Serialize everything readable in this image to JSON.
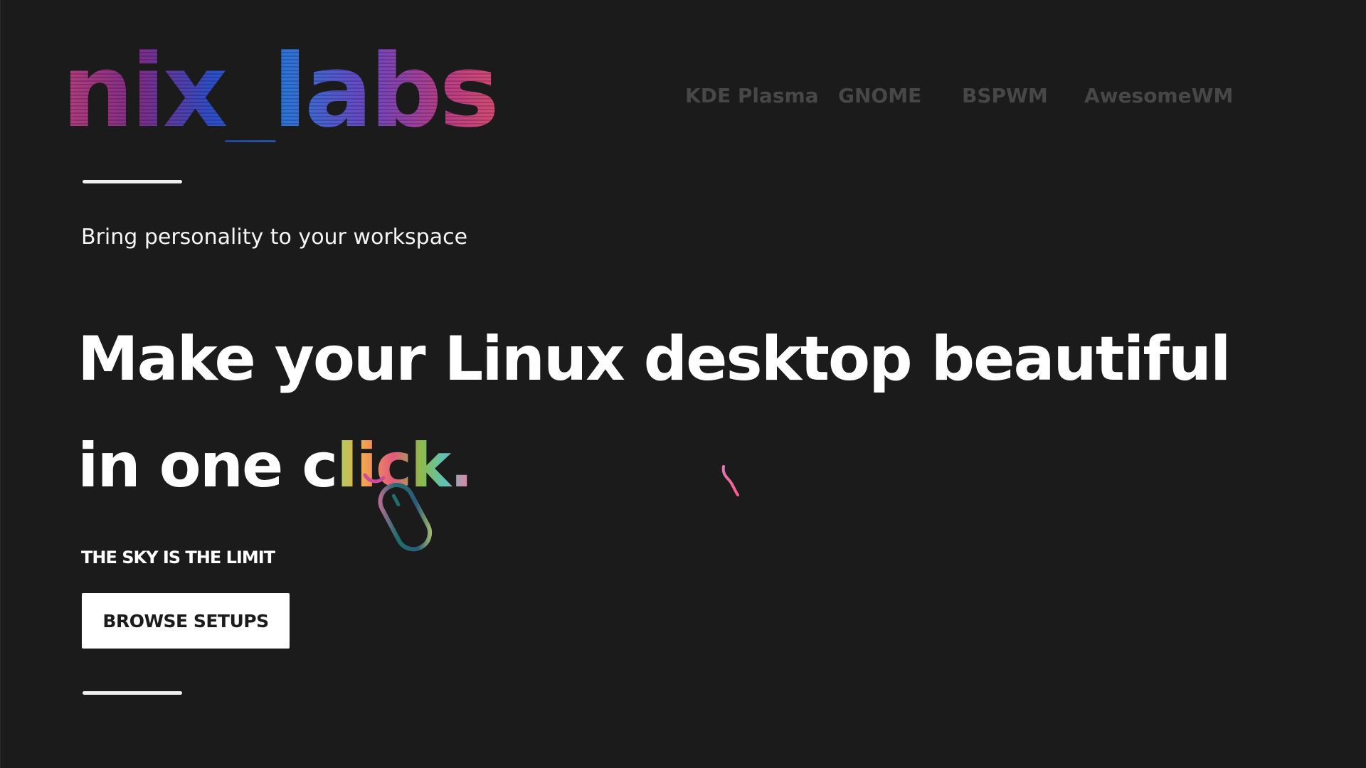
{
  "brand": {
    "logo_text": "nix_labs",
    "logo_colors": [
      "#b43d7b",
      "#2c4fc9",
      "#2e74d8",
      "#d24c71"
    ]
  },
  "nav": {
    "items": [
      {
        "label": "KDE Plasma"
      },
      {
        "label": "GNOME"
      },
      {
        "label": "BSPWM"
      },
      {
        "label": "AwesomeWM"
      }
    ],
    "color": "#474747"
  },
  "hero": {
    "tagline": "Bring personality to your workspace",
    "headline_line1": "Make your Linux desktop beautiful",
    "headline_line2_plain": "in one c",
    "headline_line2_colored": "lick.",
    "kicker": "THE SKY IS THE LIMIT",
    "cta_label": "BROWSE SETUPS",
    "icons": [
      "mouse-icon",
      "squiggle-icon"
    ]
  },
  "theme": {
    "background": "#1b1b1b",
    "text": "#ffffff",
    "button_bg": "#ffffff",
    "button_text": "#1b1b1b"
  }
}
